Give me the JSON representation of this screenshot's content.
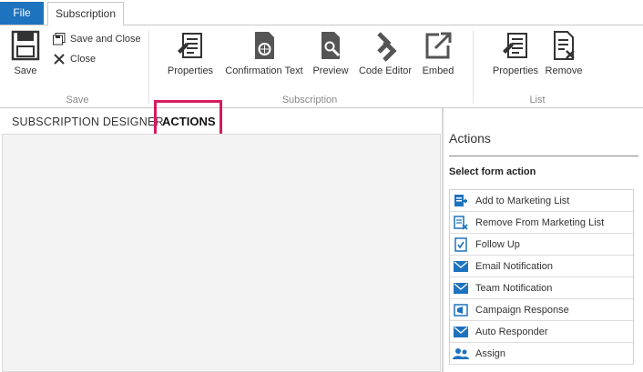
{
  "tabs": {
    "file": "File",
    "subscription": "Subscription"
  },
  "ribbon": {
    "save": {
      "label": "Save",
      "save_close": "Save and Close",
      "close": "Close",
      "group": "Save"
    },
    "subscription": {
      "properties": "Properties",
      "confirmation": "Confirmation Text",
      "preview": "Preview",
      "code_editor": "Code Editor",
      "embed": "Embed",
      "group": "Subscription"
    },
    "list": {
      "properties": "Properties",
      "remove": "Remove",
      "group": "List"
    }
  },
  "designer_tabs": {
    "designer": "SUBSCRIPTION DESIGNER",
    "actions": "ACTIONS"
  },
  "panel": {
    "title": "Actions",
    "subtitle": "Select form action",
    "items": [
      {
        "label": "Add to Marketing List",
        "icon": "add-list-icon"
      },
      {
        "label": "Remove From Marketing List",
        "icon": "remove-list-icon"
      },
      {
        "label": "Follow Up",
        "icon": "follow-up-icon"
      },
      {
        "label": "Email Notification",
        "icon": "email-icon"
      },
      {
        "label": "Team Notification",
        "icon": "email-icon"
      },
      {
        "label": "Campaign Response",
        "icon": "campaign-icon"
      },
      {
        "label": "Auto Responder",
        "icon": "email-icon"
      },
      {
        "label": "Assign",
        "icon": "assign-icon"
      }
    ]
  },
  "colors": {
    "accent": "#1e73be",
    "highlight": "#d81b60"
  }
}
